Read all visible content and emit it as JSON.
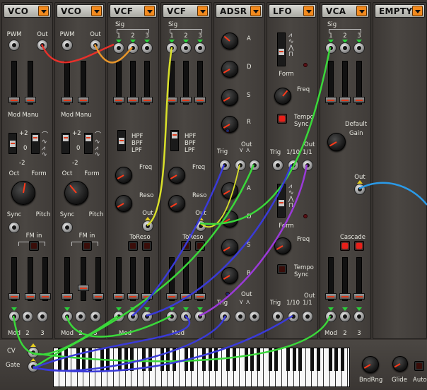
{
  "modules": [
    {
      "title": "VCO",
      "kind": "vco"
    },
    {
      "title": "VCO",
      "kind": "vco"
    },
    {
      "title": "VCF",
      "kind": "vcf"
    },
    {
      "title": "VCF",
      "kind": "vcf"
    },
    {
      "title": "ADSR",
      "kind": "adsr"
    },
    {
      "title": "LFO",
      "kind": "lfo"
    },
    {
      "title": "VCA",
      "kind": "vca"
    },
    {
      "title": "EMPTY",
      "kind": "empty"
    }
  ],
  "vco": {
    "pwm": "PWM",
    "out": "Out",
    "mod": "Mod",
    "manu": "Manu",
    "plus2": "+2",
    "zero": "0",
    "minus2": "-2",
    "oct": "Oct",
    "form": "Form",
    "sync": "Sync",
    "pitch": "Pitch",
    "fm_in": "FM in",
    "mod_bottom": "Mod",
    "two": "2",
    "three": "3"
  },
  "vcf": {
    "sig": "Sig",
    "one": "1",
    "two": "2",
    "three": "3",
    "hpf": "HPF",
    "bpf": "BPF",
    "lpf": "LPF",
    "freq": "Freq",
    "reso": "Reso",
    "out": "Out",
    "toreso": "ToReso",
    "mod": "Mod"
  },
  "adsr": {
    "a": "A",
    "d": "D",
    "s": "S",
    "r": "R",
    "trig": "Trig",
    "out": "Out"
  },
  "lfo": {
    "form": "Form",
    "freq": "Freq",
    "tempo": "Tempo",
    "sync": "Sync",
    "trig": "Trig",
    "r110": "1/10",
    "r11": "1/1",
    "out": "Out"
  },
  "vca": {
    "sig": "Sig",
    "one": "1",
    "two": "2",
    "three": "3",
    "default": "Default",
    "gain": "Gain",
    "out": "Out",
    "cascade": "Cascade",
    "mod": "Mod"
  },
  "keyboard": {
    "cv": "CV",
    "gate": "Gate",
    "bndrng": "BndRng",
    "glide": "Glide",
    "auto": "Auto"
  },
  "wire_colors": {
    "red": "#e8302a",
    "orange": "#e8962a",
    "yellow": "#d9e02a",
    "green": "#3ad83a",
    "blue": "#3a3ad8",
    "purple": "#9a3ad8",
    "cyan": "#2a9ae8"
  }
}
